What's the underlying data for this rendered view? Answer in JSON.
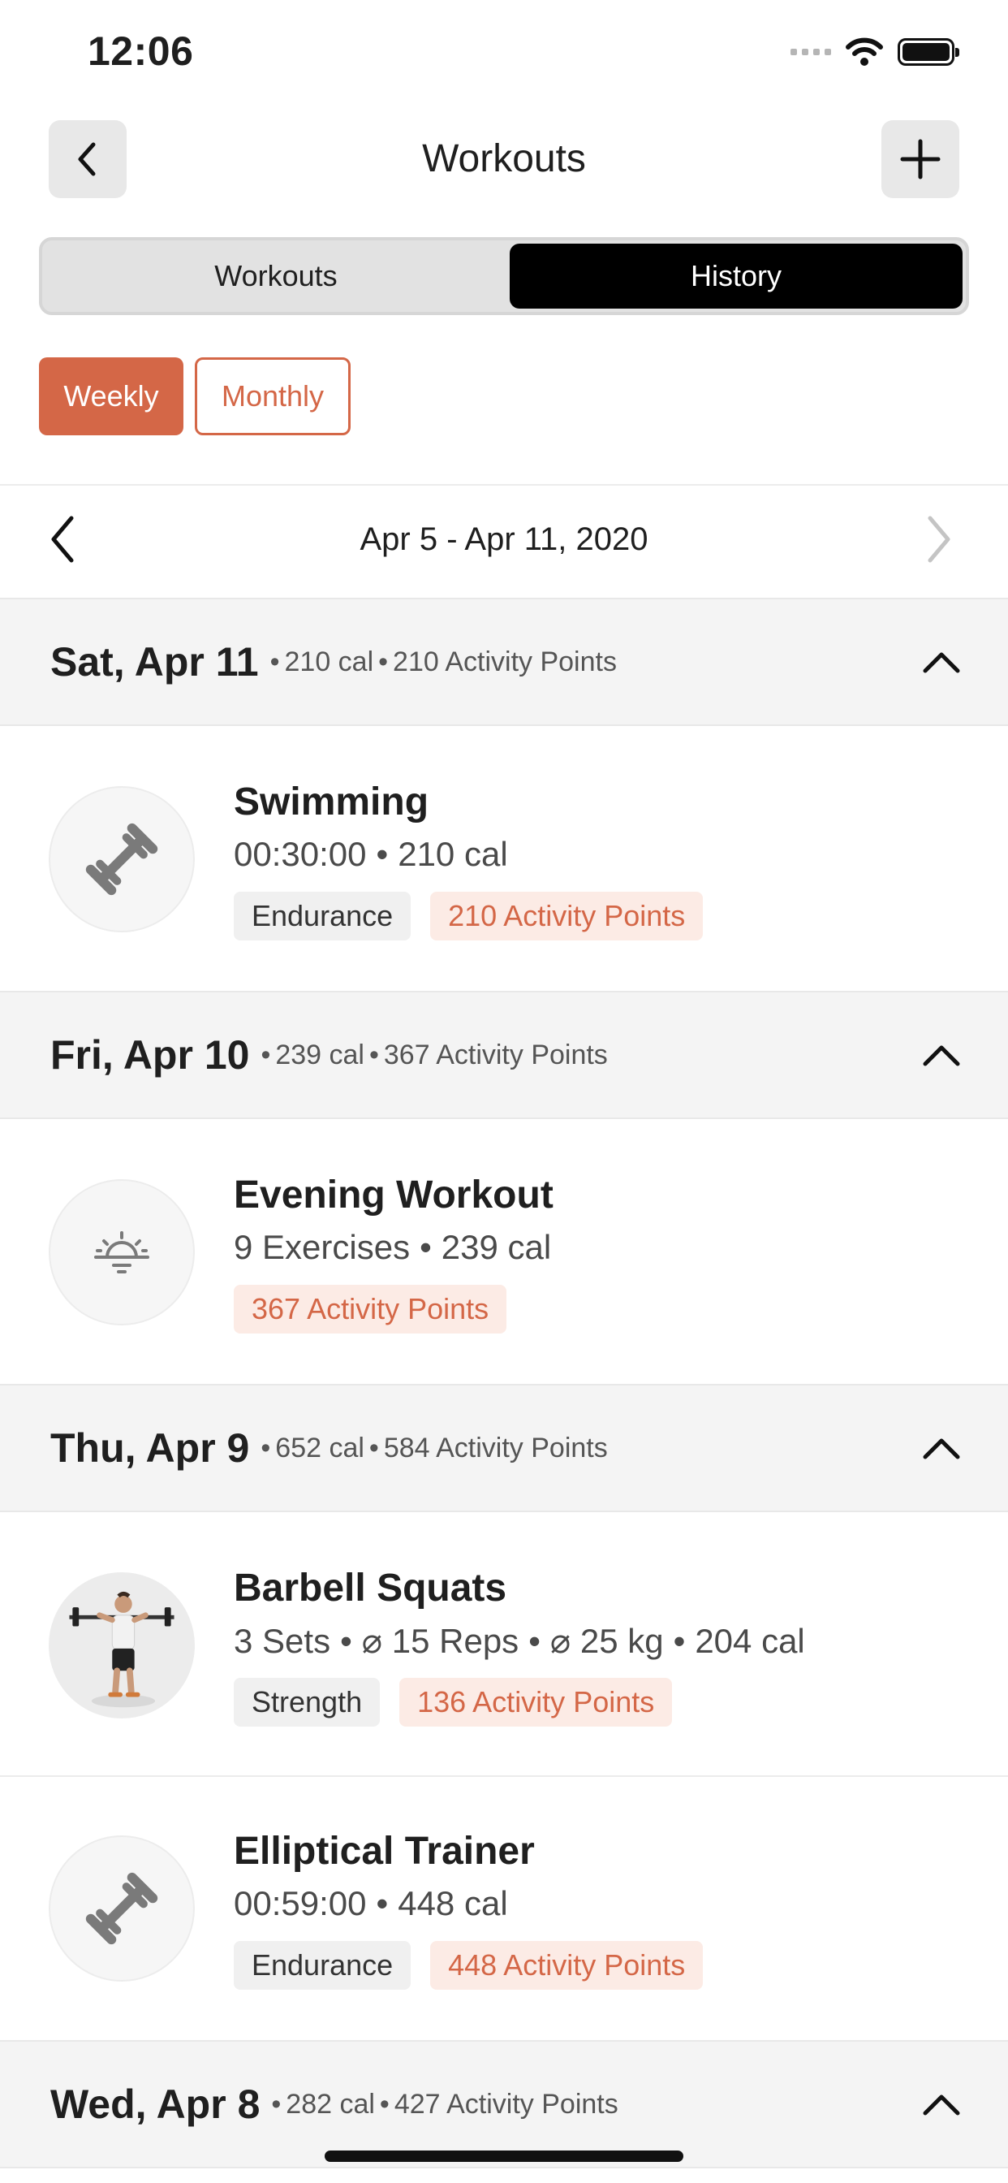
{
  "status_bar": {
    "time": "12:06"
  },
  "nav": {
    "title": "Workouts",
    "back_icon": "chevron-left-icon",
    "add_icon": "plus-icon"
  },
  "segment": {
    "workouts_label": "Workouts",
    "history_label": "History",
    "selected": "History"
  },
  "period": {
    "weekly_label": "Weekly",
    "monthly_label": "Monthly",
    "selected": "Weekly"
  },
  "week": {
    "label": "Apr 5 - Apr 11, 2020"
  },
  "colors": {
    "accent": "#d46747",
    "tag_orange_bg": "#fcebe5",
    "tag_grey_bg": "#f0f0f0",
    "header_bg": "#f4f4f4"
  },
  "days": [
    {
      "day": "Sat, Apr 11",
      "cal": "210 cal",
      "points": "210 Activity Points",
      "items": [
        {
          "title": "Swimming",
          "sub": [
            "00:30:00",
            "210 cal"
          ],
          "tag": "Endurance",
          "points": "210 Activity Points",
          "icon": "dumbbell-icon"
        }
      ]
    },
    {
      "day": "Fri, Apr 10",
      "cal": "239 cal",
      "points": "367 Activity Points",
      "items": [
        {
          "title": "Evening Workout",
          "sub": [
            "9 Exercises",
            "239 cal"
          ],
          "points": "367 Activity Points",
          "icon": "sunset-icon"
        }
      ]
    },
    {
      "day": "Thu, Apr 9",
      "cal": "652 cal",
      "points": "584 Activity Points",
      "items": [
        {
          "title": "Barbell Squats",
          "sub": [
            "3 Sets",
            "⌀ 15 Reps",
            "⌀ 25 kg",
            "204 cal"
          ],
          "tag": "Strength",
          "points": "136 Activity Points",
          "icon": "barbell-squat-figure"
        },
        {
          "title": "Elliptical Trainer",
          "sub": [
            "00:59:00",
            "448 cal"
          ],
          "tag": "Endurance",
          "points": "448 Activity Points",
          "icon": "dumbbell-icon"
        }
      ]
    },
    {
      "day": "Wed, Apr 8",
      "cal": "282 cal",
      "points": "427 Activity Points",
      "items": []
    }
  ]
}
